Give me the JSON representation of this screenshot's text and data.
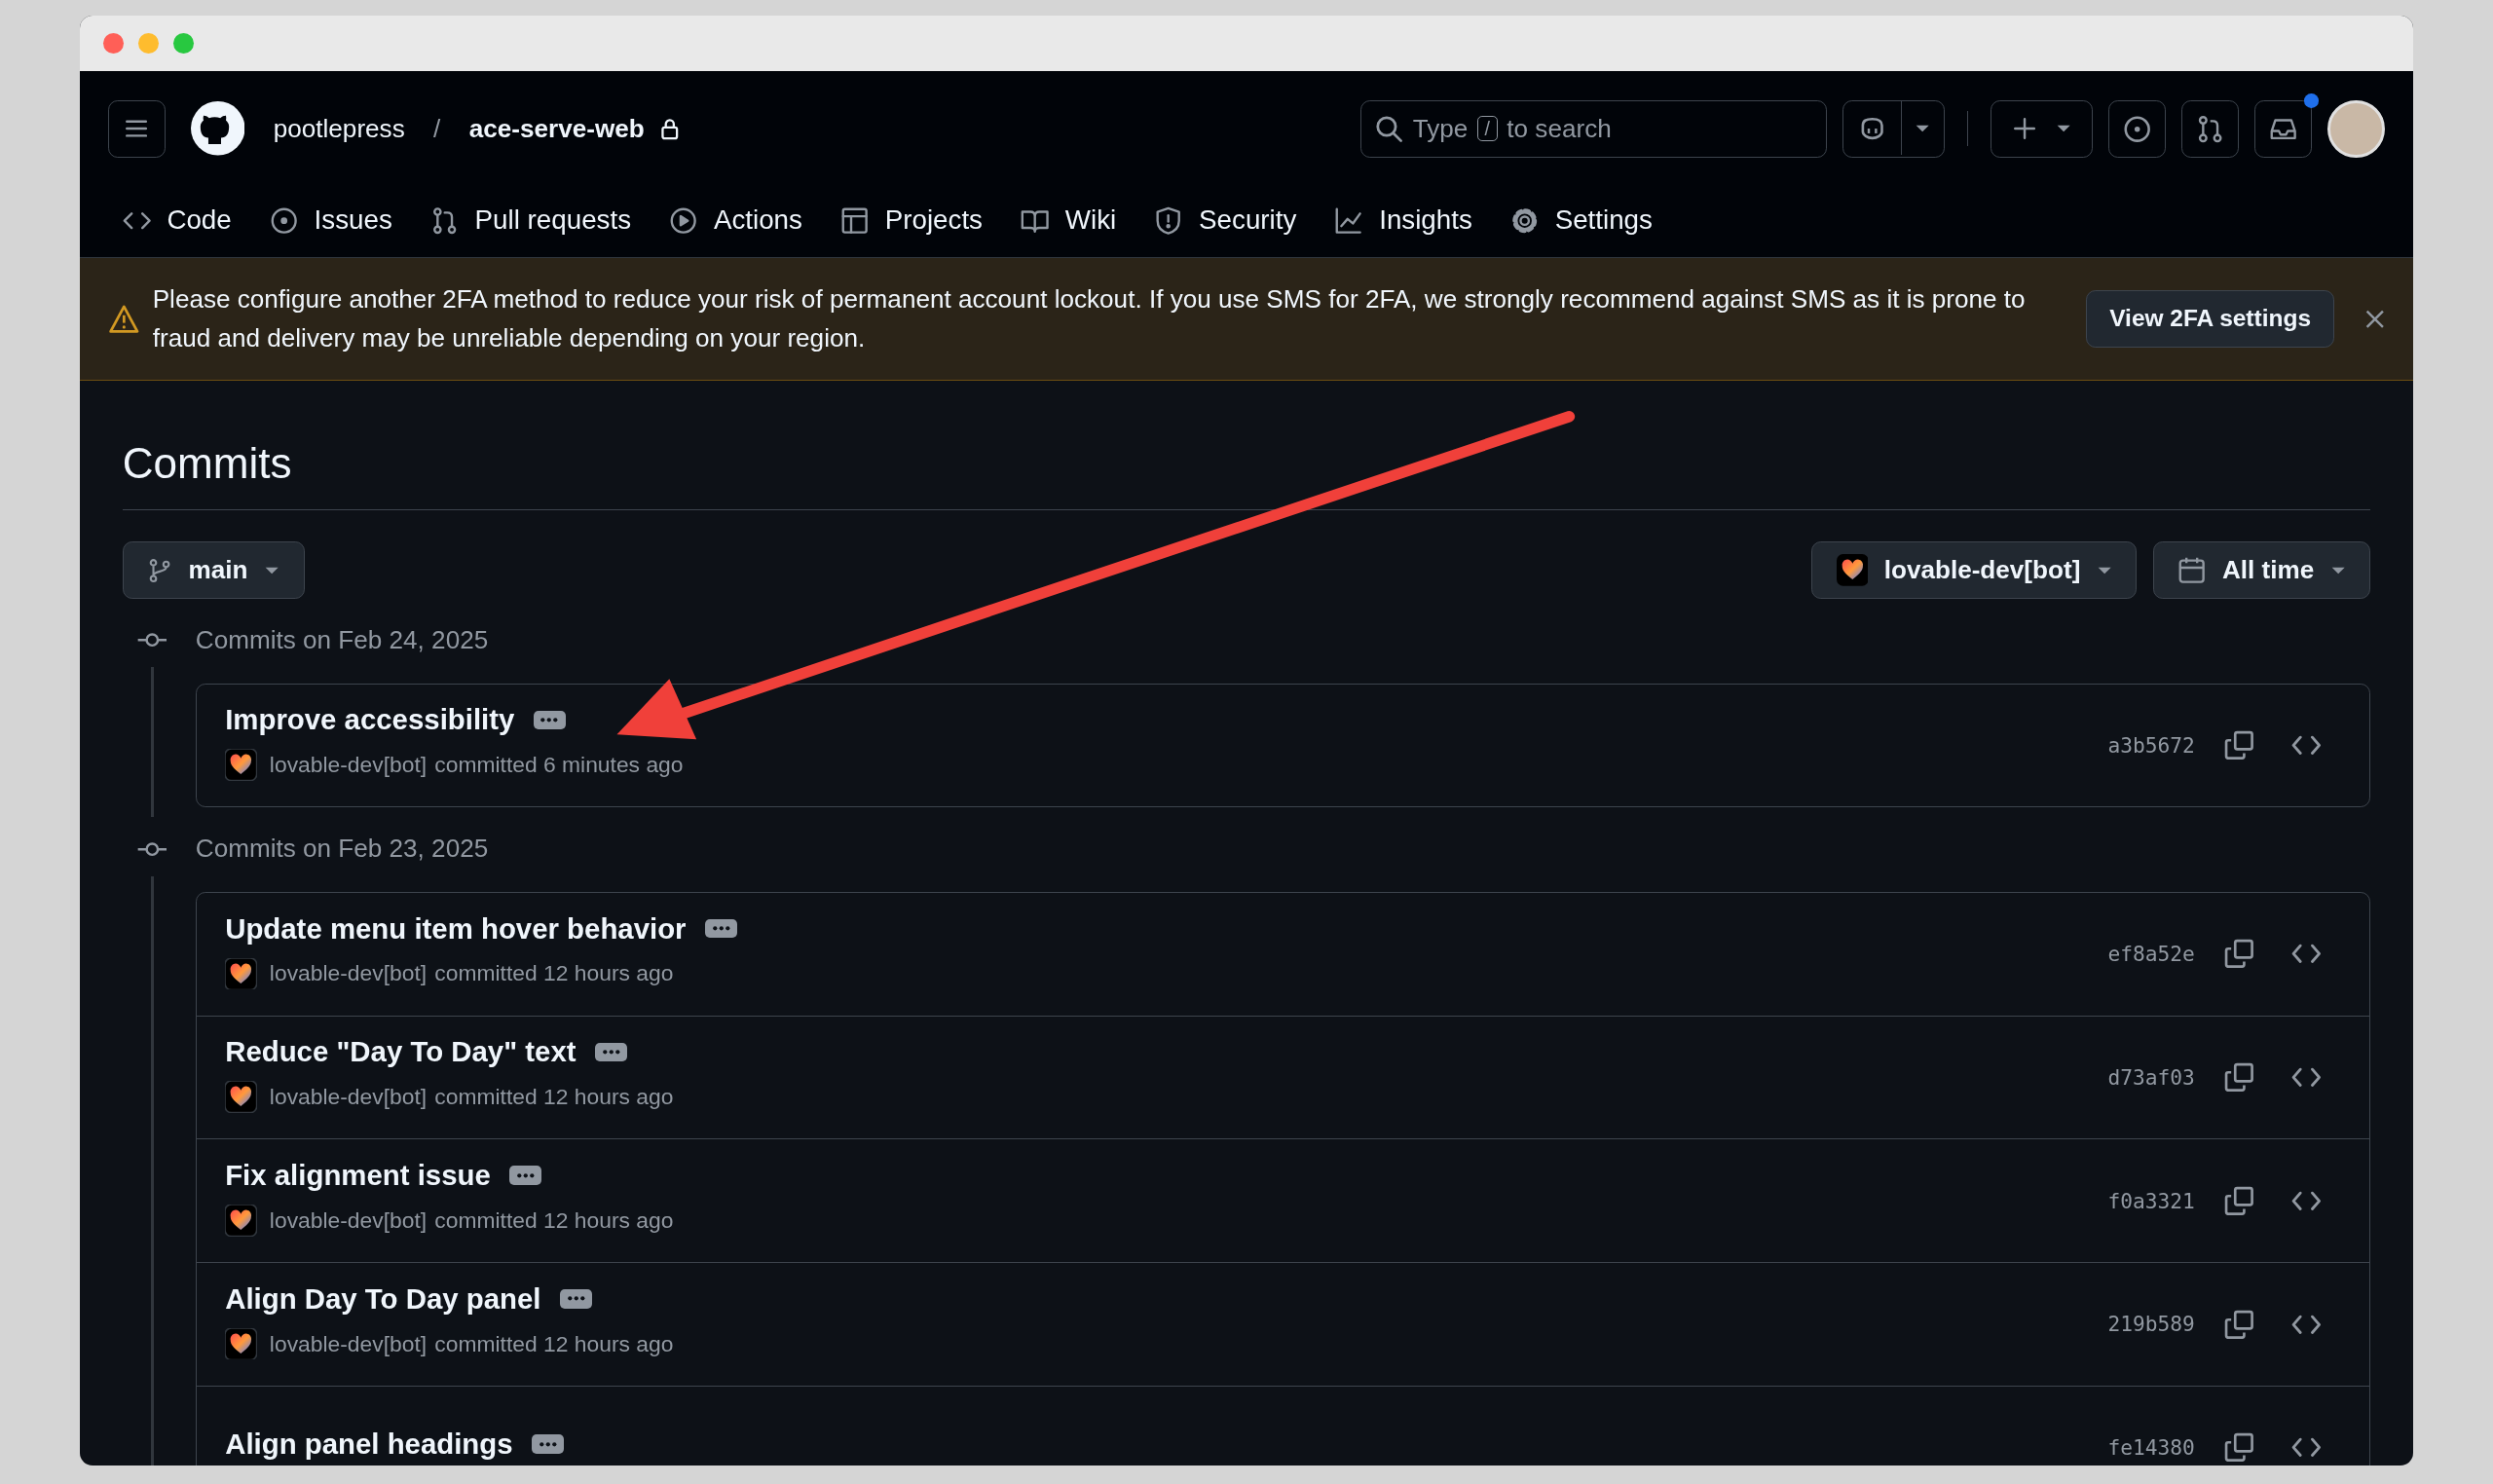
{
  "header": {
    "owner": "pootlepress",
    "separator": "/",
    "repo": "ace-serve-web",
    "search": {
      "hint_prefix": "Type",
      "key": "/",
      "hint_suffix": "to search"
    },
    "inbox": {
      "unread": true
    }
  },
  "nav": [
    {
      "label": "Code",
      "selected": false
    },
    {
      "label": "Issues",
      "selected": false
    },
    {
      "label": "Pull requests",
      "selected": false
    },
    {
      "label": "Actions",
      "selected": false
    },
    {
      "label": "Projects",
      "selected": false
    },
    {
      "label": "Wiki",
      "selected": false
    },
    {
      "label": "Security",
      "selected": false
    },
    {
      "label": "Insights",
      "selected": false
    },
    {
      "label": "Settings",
      "selected": false
    }
  ],
  "banner": {
    "text": "Please configure another 2FA method to reduce your risk of permanent account lockout. If you use SMS for 2FA, we strongly recommend against SMS as it is prone to fraud and delivery may be unreliable depending on your region.",
    "button": "View 2FA settings"
  },
  "page_title": "Commits",
  "filters": {
    "branch": "main",
    "author": "lovable-dev[bot]",
    "date": "All time"
  },
  "groups": [
    {
      "heading": "Commits on Feb 24, 2025",
      "commits": [
        {
          "title": "Improve accessibility",
          "author": "lovable-dev[bot]",
          "meta": "committed 6 minutes ago",
          "sha": "a3b5672"
        }
      ]
    },
    {
      "heading": "Commits on Feb 23, 2025",
      "commits": [
        {
          "title": "Update menu item hover behavior",
          "author": "lovable-dev[bot]",
          "meta": "committed 12 hours ago",
          "sha": "ef8a52e"
        },
        {
          "title": "Reduce \"Day To Day\" text",
          "author": "lovable-dev[bot]",
          "meta": "committed 12 hours ago",
          "sha": "d73af03"
        },
        {
          "title": "Fix alignment issue",
          "author": "lovable-dev[bot]",
          "meta": "committed 12 hours ago",
          "sha": "f0a3321"
        },
        {
          "title": "Align Day To Day panel",
          "author": "lovable-dev[bot]",
          "meta": "committed 12 hours ago",
          "sha": "219b589"
        },
        {
          "title": "Align panel headings",
          "sha": "fe14380"
        }
      ]
    }
  ]
}
